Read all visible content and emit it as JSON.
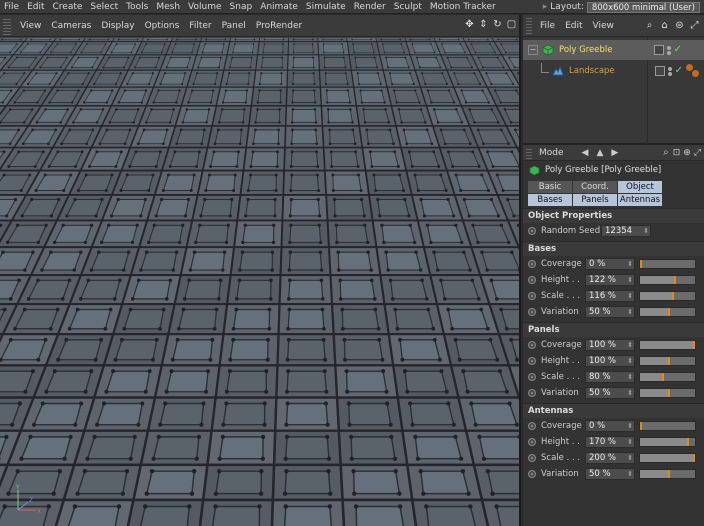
{
  "menubar": {
    "items": [
      "File",
      "Edit",
      "Create",
      "Select",
      "Tools",
      "Mesh",
      "Volume",
      "Snap",
      "Animate",
      "Simulate",
      "Render",
      "Sculpt",
      "Motion Tracker"
    ],
    "layout_label": "Layout:",
    "layout_value": "800x600 minimal (User)"
  },
  "viewport": {
    "menu": [
      "View",
      "Cameras",
      "Display",
      "Options",
      "Filter",
      "Panel",
      "ProRender"
    ],
    "nav_icons": [
      "move-icon",
      "dolly-icon",
      "rotate-icon",
      "maximize-icon"
    ],
    "axis": {
      "y": "Y",
      "x": "X",
      "z": "Z"
    }
  },
  "object_manager": {
    "menu": [
      "File",
      "Edit",
      "View"
    ],
    "objects": [
      {
        "name": "Poly Greeble",
        "level": 0,
        "selected": true
      },
      {
        "name": "Landscape",
        "level": 1,
        "selected": false
      }
    ]
  },
  "attributes": {
    "mode_label": "Mode",
    "object_title": "Poly Greeble [Poly Greeble]",
    "tabs": [
      {
        "label": "Basic",
        "active": false
      },
      {
        "label": "Coord.",
        "active": false
      },
      {
        "label": "Object",
        "active": true
      },
      {
        "label": "Bases",
        "active": true
      },
      {
        "label": "Panels",
        "active": true
      },
      {
        "label": "Antennas",
        "active": true
      }
    ],
    "object_properties": {
      "title": "Object Properties",
      "random_seed_label": "Random Seed",
      "random_seed_value": "12354"
    },
    "groups": [
      {
        "title": "Bases",
        "params": [
          {
            "label": "Coverage",
            "value": "0 %",
            "level": 0.0
          },
          {
            "label": "Height . .",
            "value": "122 %",
            "level": 0.61
          },
          {
            "label": "Scale . . .",
            "value": "116 %",
            "level": 0.58
          },
          {
            "label": "Variation",
            "value": "50 %",
            "level": 0.5
          }
        ]
      },
      {
        "title": "Panels",
        "params": [
          {
            "label": "Coverage",
            "value": "100 %",
            "level": 1.0
          },
          {
            "label": "Height . .",
            "value": "100 %",
            "level": 0.5
          },
          {
            "label": "Scale . . .",
            "value": "80 %",
            "level": 0.4
          },
          {
            "label": "Variation",
            "value": "50 %",
            "level": 0.5
          }
        ]
      },
      {
        "title": "Antennas",
        "params": [
          {
            "label": "Coverage",
            "value": "0 %",
            "level": 0.0
          },
          {
            "label": "Height . .",
            "value": "170 %",
            "level": 0.85
          },
          {
            "label": "Scale . . .",
            "value": "200 %",
            "level": 1.0
          },
          {
            "label": "Variation",
            "value": "50 %",
            "level": 0.5
          }
        ]
      }
    ]
  },
  "colors": {
    "accent_orange": "#e08a1a",
    "selection": "#5c5c5c",
    "tab_active": "#b7c5dc",
    "object_name_selected": "#f0e070",
    "object_name_child": "#d8a040"
  }
}
